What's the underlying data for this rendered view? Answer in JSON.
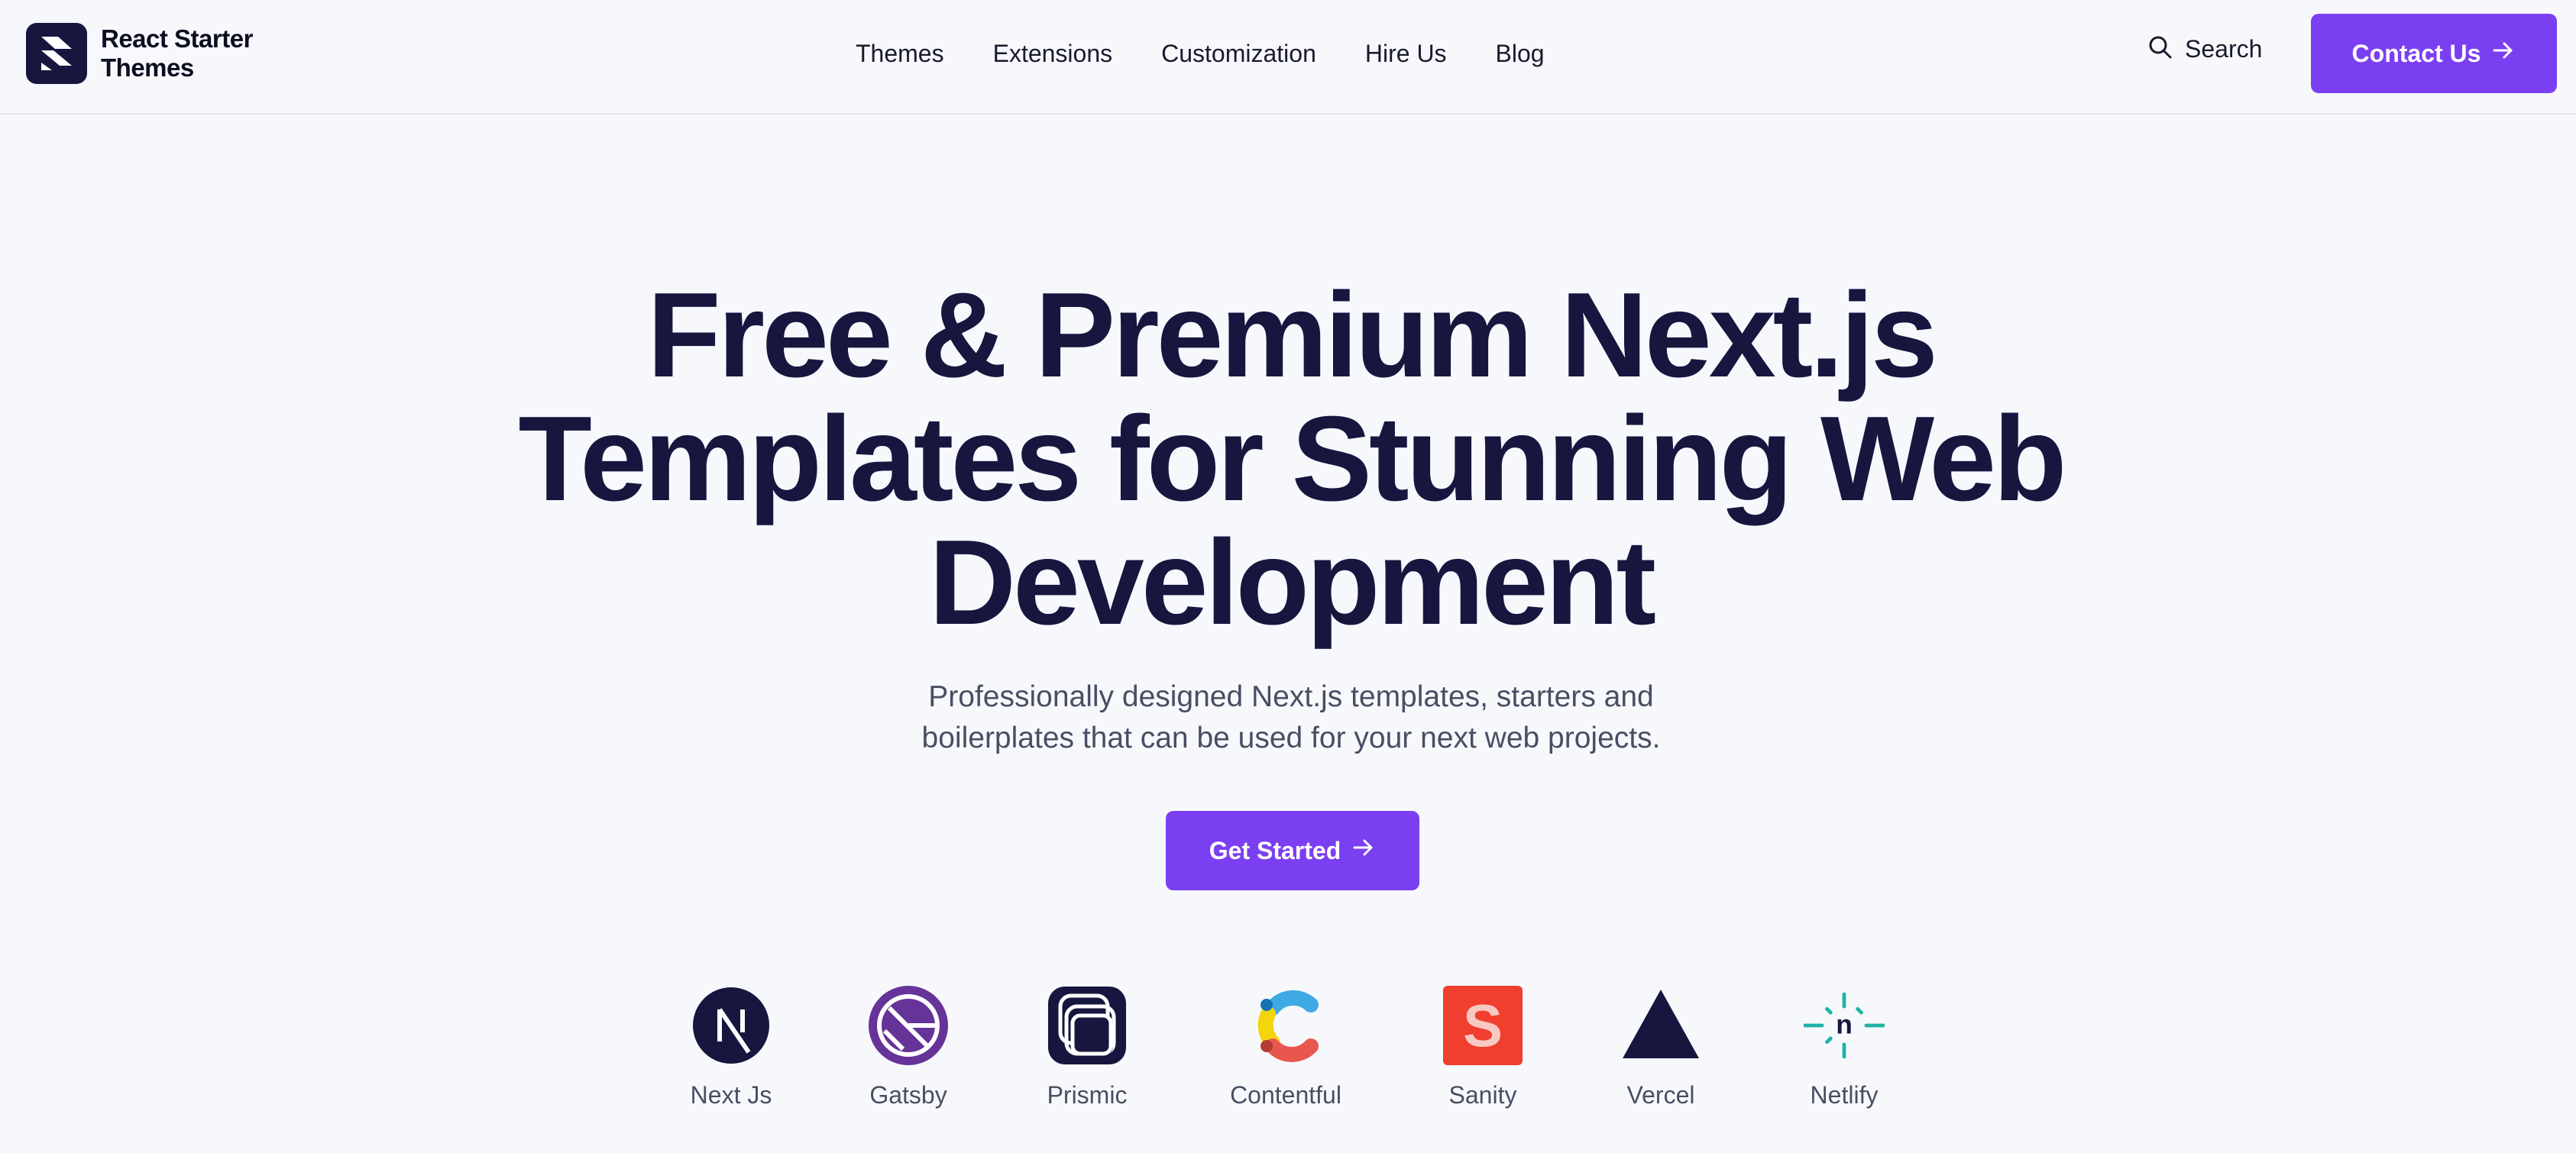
{
  "brand": {
    "line1": "React Starter",
    "line2": "Themes",
    "icon": "lightning-logo-icon"
  },
  "nav": {
    "items": [
      {
        "label": "Themes"
      },
      {
        "label": "Extensions"
      },
      {
        "label": "Customization"
      },
      {
        "label": "Hire Us"
      },
      {
        "label": "Blog"
      }
    ]
  },
  "search": {
    "label": "Search",
    "icon": "search-icon"
  },
  "contact": {
    "label": "Contact Us",
    "icon": "arrow-right-icon"
  },
  "hero": {
    "title_lines": [
      "Free & Premium Next.js",
      "Templates for Stunning Web",
      "Development"
    ],
    "subtitle_lines": [
      "Professionally designed Next.js templates, starters and",
      "boilerplates that can be used for your next web projects."
    ],
    "cta_label": "Get Started"
  },
  "tech": [
    {
      "label": "Next Js",
      "icon": "nextjs-icon"
    },
    {
      "label": "Gatsby",
      "icon": "gatsby-icon"
    },
    {
      "label": "Prismic",
      "icon": "prismic-icon"
    },
    {
      "label": "Contentful",
      "icon": "contentful-icon"
    },
    {
      "label": "Sanity",
      "icon": "sanity-icon"
    },
    {
      "label": "Vercel",
      "icon": "vercel-icon"
    },
    {
      "label": "Netlify",
      "icon": "netlify-icon"
    }
  ],
  "colors": {
    "accent": "#7b3ff2",
    "ink": "#16163f",
    "muted": "#4b4d63",
    "background": "#f7f8fc"
  }
}
